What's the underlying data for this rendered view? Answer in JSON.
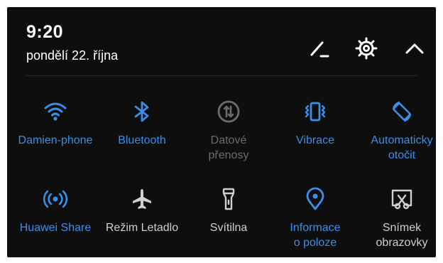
{
  "status": {
    "time": "9:20",
    "date": "pondělí 22. října"
  },
  "header_icons": [
    "edit-icon",
    "settings-gear-icon",
    "collapse-chevron-up-icon"
  ],
  "colors": {
    "accent": "#3a8ee8",
    "inactive": "#cfcfcf",
    "disabled": "#6c6c6c",
    "background": "#0e0e0e"
  },
  "tiles": [
    {
      "label": "Damien-phone",
      "icon": "wifi-icon",
      "state": "on"
    },
    {
      "label": "Bluetooth",
      "icon": "bluetooth-icon",
      "state": "on"
    },
    {
      "label": "Datové\npřenosy",
      "icon": "mobile-data-icon",
      "state": "disabled"
    },
    {
      "label": "Vibrace",
      "icon": "vibrate-icon",
      "state": "on"
    },
    {
      "label": "Automaticky\notočit",
      "icon": "auto-rotate-icon",
      "state": "on"
    },
    {
      "label": "Huawei Share",
      "icon": "huawei-share-icon",
      "state": "on"
    },
    {
      "label": "Režim Letadlo",
      "icon": "airplane-icon",
      "state": "off"
    },
    {
      "label": "Svítilna",
      "icon": "flashlight-icon",
      "state": "off"
    },
    {
      "label": "Informace\no poloze",
      "icon": "location-icon",
      "state": "on"
    },
    {
      "label": "Snímek\nobrazovky",
      "icon": "screenshot-icon",
      "state": "off"
    }
  ]
}
